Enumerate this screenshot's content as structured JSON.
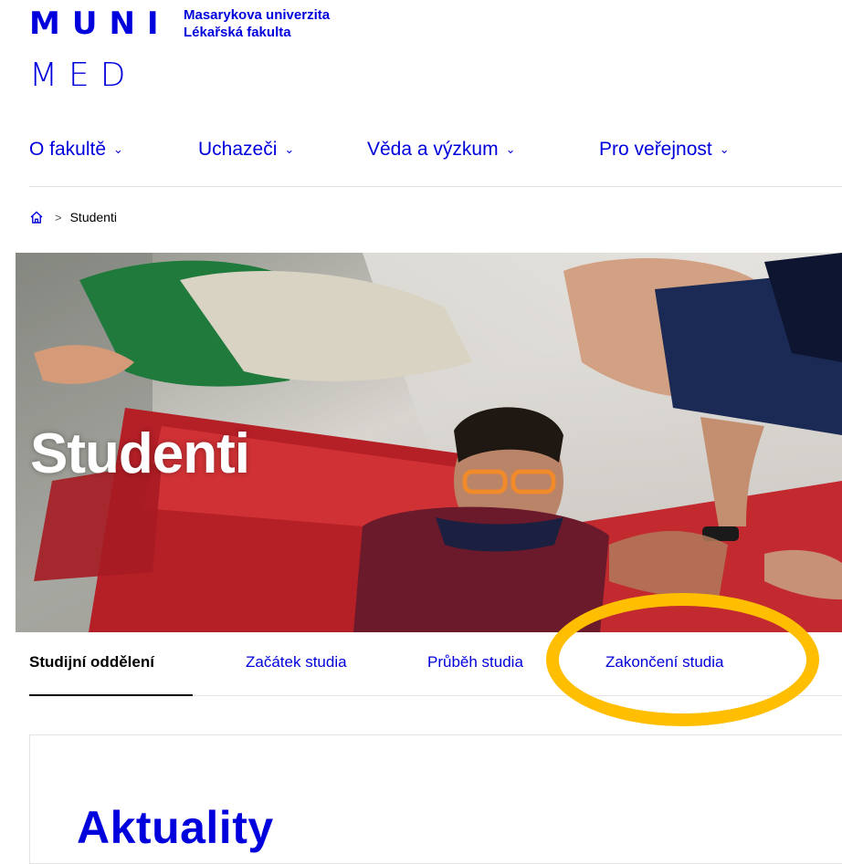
{
  "logo": {
    "muni": "MUNI",
    "med": "MED",
    "university": "Masarykova univerzita",
    "faculty": "Lékařská fakulta"
  },
  "main_nav": {
    "items": [
      {
        "label": "O fakultě"
      },
      {
        "label": "Uchazeči"
      },
      {
        "label": "Věda a výzkum"
      },
      {
        "label": "Pro veřejnost"
      }
    ],
    "chevron": "⌄"
  },
  "breadcrumb": {
    "separator": ">",
    "current": "Studenti"
  },
  "hero": {
    "title": "Studenti"
  },
  "sub_nav": {
    "tabs": [
      {
        "label": "Studijní oddělení",
        "active": true
      },
      {
        "label": "Začátek studia"
      },
      {
        "label": "Průběh studia"
      },
      {
        "label": "Zakončení studia"
      }
    ]
  },
  "content": {
    "section_title": "Aktuality"
  },
  "colors": {
    "brand": "#0000dc",
    "highlight": "#ffbe00",
    "hero_red": "#c0232b"
  }
}
